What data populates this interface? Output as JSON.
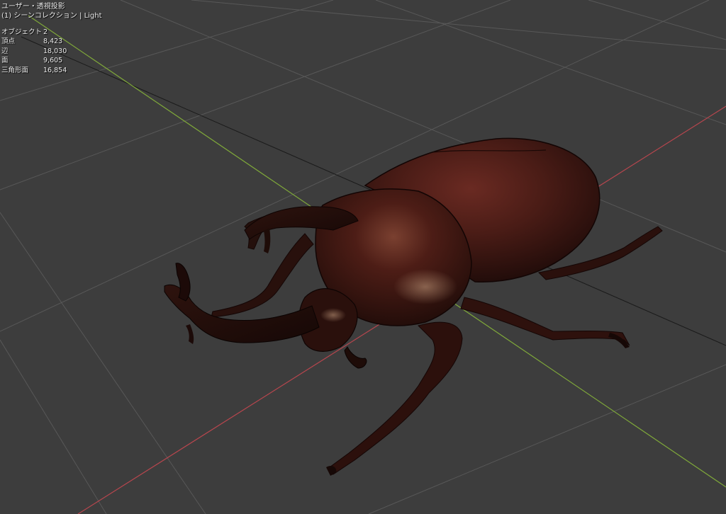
{
  "viewport": {
    "view_label": "ユーザー・透視投影",
    "collection_label": "(1) シーンコレクション | Light"
  },
  "stats": [
    {
      "label": "オブジェクト",
      "value": "2"
    },
    {
      "label": "頂点",
      "value": "8,423"
    },
    {
      "label": "辺",
      "value": "18,030"
    },
    {
      "label": "面",
      "value": "9,605"
    },
    {
      "label": "三角形面",
      "value": "16,854"
    }
  ],
  "colors": {
    "background": "#3d3d3d",
    "grid": "#5a5a5a",
    "x_axis": "#b8464e",
    "y_axis": "#7fa83a",
    "beetle_body": "#3a1712"
  },
  "icons": {
    "model": "rhinoceros-beetle-model"
  }
}
